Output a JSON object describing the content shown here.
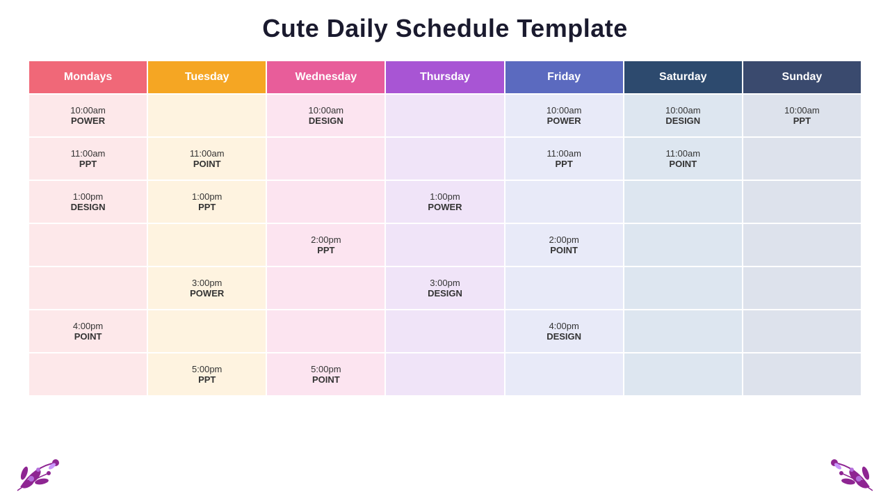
{
  "title": "Cute Daily Schedule Template",
  "headers": [
    {
      "id": "monday",
      "label": "Mondays",
      "class": "th-monday"
    },
    {
      "id": "tuesday",
      "label": "Tuesday",
      "class": "th-tuesday"
    },
    {
      "id": "wednesday",
      "label": "Wednesday",
      "class": "th-wednesday"
    },
    {
      "id": "thursday",
      "label": "Thursday",
      "class": "th-thursday"
    },
    {
      "id": "friday",
      "label": "Friday",
      "class": "th-friday"
    },
    {
      "id": "saturday",
      "label": "Saturday",
      "class": "th-saturday"
    },
    {
      "id": "sunday",
      "label": "Sunday",
      "class": "th-sunday"
    }
  ],
  "rows": [
    {
      "monday": {
        "time": "10:00am",
        "label": "POWER"
      },
      "tuesday": {
        "time": "",
        "label": ""
      },
      "wednesday": {
        "time": "10:00am",
        "label": "DESIGN"
      },
      "thursday": {
        "time": "",
        "label": ""
      },
      "friday": {
        "time": "10:00am",
        "label": "POWER"
      },
      "saturday": {
        "time": "10:00am",
        "label": "DESIGN"
      },
      "sunday": {
        "time": "10:00am",
        "label": "PPT"
      }
    },
    {
      "monday": {
        "time": "11:00am",
        "label": "PPT"
      },
      "tuesday": {
        "time": "11:00am",
        "label": "POINT"
      },
      "wednesday": {
        "time": "",
        "label": ""
      },
      "thursday": {
        "time": "",
        "label": ""
      },
      "friday": {
        "time": "11:00am",
        "label": "PPT"
      },
      "saturday": {
        "time": "11:00am",
        "label": "POINT"
      },
      "sunday": {
        "time": "",
        "label": ""
      }
    },
    {
      "monday": {
        "time": "1:00pm",
        "label": "DESIGN"
      },
      "tuesday": {
        "time": "1:00pm",
        "label": "PPT"
      },
      "wednesday": {
        "time": "",
        "label": ""
      },
      "thursday": {
        "time": "1:00pm",
        "label": "POWER"
      },
      "friday": {
        "time": "",
        "label": ""
      },
      "saturday": {
        "time": "",
        "label": ""
      },
      "sunday": {
        "time": "",
        "label": ""
      }
    },
    {
      "monday": {
        "time": "",
        "label": ""
      },
      "tuesday": {
        "time": "",
        "label": ""
      },
      "wednesday": {
        "time": "2:00pm",
        "label": "PPT"
      },
      "thursday": {
        "time": "",
        "label": ""
      },
      "friday": {
        "time": "2:00pm",
        "label": "POINT"
      },
      "saturday": {
        "time": "",
        "label": ""
      },
      "sunday": {
        "time": "",
        "label": ""
      }
    },
    {
      "monday": {
        "time": "",
        "label": ""
      },
      "tuesday": {
        "time": "3:00pm",
        "label": "POWER"
      },
      "wednesday": {
        "time": "",
        "label": ""
      },
      "thursday": {
        "time": "3:00pm",
        "label": "DESIGN"
      },
      "friday": {
        "time": "",
        "label": ""
      },
      "saturday": {
        "time": "",
        "label": ""
      },
      "sunday": {
        "time": "",
        "label": ""
      }
    },
    {
      "monday": {
        "time": "4:00pm",
        "label": "POINT"
      },
      "tuesday": {
        "time": "",
        "label": ""
      },
      "wednesday": {
        "time": "",
        "label": ""
      },
      "thursday": {
        "time": "",
        "label": ""
      },
      "friday": {
        "time": "4:00pm",
        "label": "DESIGN"
      },
      "saturday": {
        "time": "",
        "label": ""
      },
      "sunday": {
        "time": "",
        "label": ""
      }
    },
    {
      "monday": {
        "time": "",
        "label": ""
      },
      "tuesday": {
        "time": "5:00pm",
        "label": "PPT"
      },
      "wednesday": {
        "time": "5:00pm",
        "label": "POINT"
      },
      "thursday": {
        "time": "",
        "label": ""
      },
      "friday": {
        "time": "",
        "label": ""
      },
      "saturday": {
        "time": "",
        "label": ""
      },
      "sunday": {
        "time": "",
        "label": ""
      }
    }
  ],
  "floral_color": "#7b0080"
}
